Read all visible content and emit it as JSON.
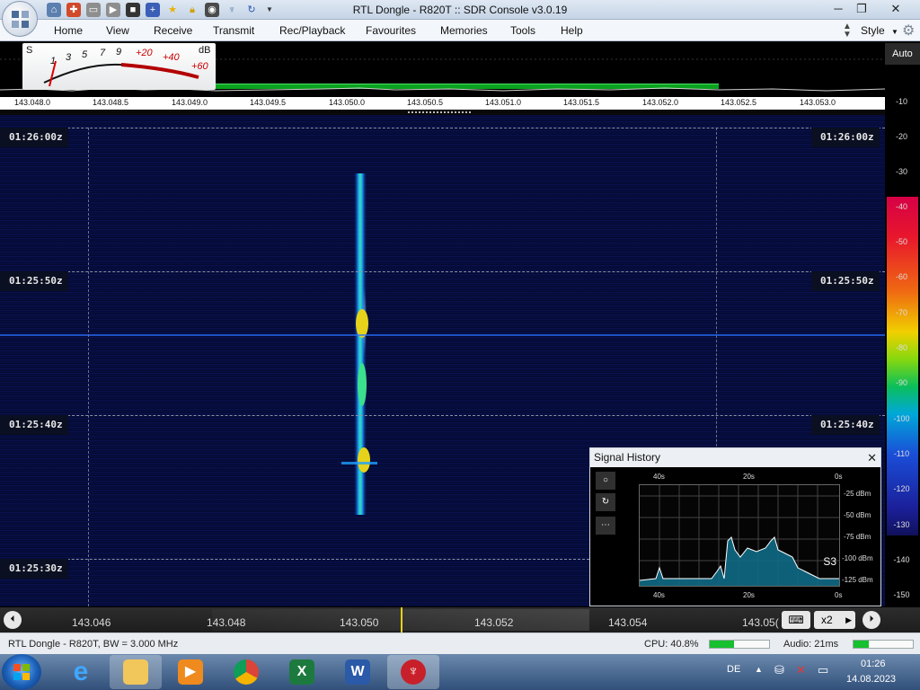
{
  "window": {
    "title": "RTL Dongle - R820T :: SDR Console v3.0.19"
  },
  "menu": {
    "items": [
      "Home",
      "View",
      "Receive",
      "Transmit",
      "Rec/Playback",
      "Favourites",
      "Memories",
      "Tools",
      "Help"
    ],
    "style_label": "Style"
  },
  "smeter": {
    "s_label": "S",
    "db_label": "dB",
    "scale": [
      "1",
      "3",
      "5",
      "7",
      "9",
      "+20",
      "+40",
      "+60"
    ]
  },
  "spectrum": {
    "freq_labels": [
      "143.048.0",
      "143.048.5",
      "143.049.0",
      "143.049.5",
      "143.050.0",
      "143.050.5",
      "143.051.0",
      "143.051.5",
      "143.052.0",
      "143.052.5",
      "143.053.0"
    ]
  },
  "waterfall": {
    "timestamps": [
      "01:26:00z",
      "01:25:50z",
      "01:25:40z",
      "01:25:30z"
    ]
  },
  "db_scale": {
    "auto_label": "Auto",
    "labels": [
      "-10",
      "-20",
      "-30",
      "-40",
      "-50",
      "-60",
      "-70",
      "-80",
      "-90",
      "-100",
      "-110",
      "-120",
      "-130",
      "-140",
      "-150"
    ]
  },
  "signal_history": {
    "title": "Signal History",
    "close": "✕",
    "time_top": [
      "40s",
      "20s",
      "0s"
    ],
    "time_bottom": [
      "40s",
      "20s",
      "0s"
    ],
    "dbm_labels": [
      "-25 dBm",
      "-50 dBm",
      "-75 dBm",
      "-100 dBm",
      "-125 dBm"
    ],
    "s_value": "S3",
    "tools": [
      "○",
      "↻",
      "⋯"
    ]
  },
  "bottom_freq": {
    "labels": [
      "143.046",
      "143.048",
      "143.050",
      "143.052",
      "143.054",
      "143.05("
    ],
    "zoom_label": "x2"
  },
  "status": {
    "device": "RTL Dongle - R820T, BW = 3.000 MHz",
    "cpu": "CPU: 40.8%",
    "cpu_level": 0.408,
    "audio": "Audio: 21ms",
    "audio_level": 0.25
  },
  "taskbar": {
    "apps": [
      "internet-explorer",
      "file-explorer",
      "media-player",
      "chrome",
      "excel",
      "word",
      "sdr-console"
    ],
    "lang": "DE",
    "time": "01:26",
    "date": "14.08.2023"
  },
  "colors": {
    "waterfall_bg": "#050b36",
    "signal": "#1fd0ff",
    "signal_peak": "#ffd400",
    "spectrum_green": "#0aa21e"
  }
}
